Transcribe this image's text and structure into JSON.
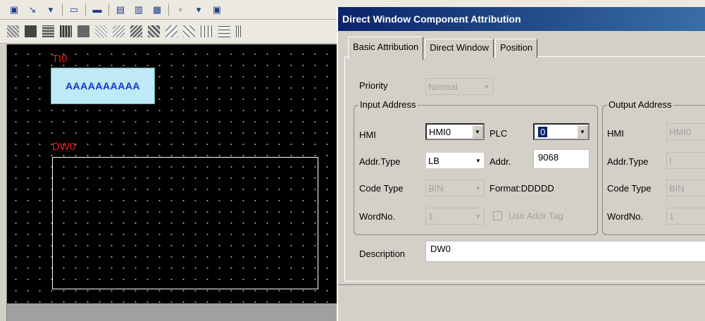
{
  "canvas": {
    "ti0_label": "TI0",
    "ti0_text": "AAAAAAAAAA",
    "dw0_label": "DW0"
  },
  "dialog": {
    "title": "Direct Window Component Attribution",
    "tabs": [
      "Basic Attribution",
      "Direct Window",
      "Position"
    ],
    "priority": {
      "label": "Priority",
      "value": "Normal"
    },
    "input_address": {
      "title": "Input Address",
      "hmi_label": "HMI",
      "hmi_value": "HMI0",
      "plc_label": "PLC",
      "plc_value": "0",
      "addr_type_label": "Addr.Type",
      "addr_type_value": "LB",
      "addr_label": "Addr.",
      "addr_value": "9068",
      "code_type_label": "Code Type",
      "code_type_value": "BIN",
      "format_label": "Format:DDDDD",
      "wordno_label": "WordNo.",
      "wordno_value": "1",
      "use_addr_tag_label": "Use Addr Tag"
    },
    "output_address": {
      "title": "Output Address",
      "hmi_label": "HMI",
      "hmi_value": "HMI0",
      "addr_type_label": "Addr.Type",
      "addr_type_value": "I",
      "code_type_label": "Code Type",
      "code_type_value": "BIN",
      "wordno_label": "WordNo.",
      "wordno_value": "1"
    },
    "description": {
      "label": "Description",
      "value": "DW0"
    }
  }
}
